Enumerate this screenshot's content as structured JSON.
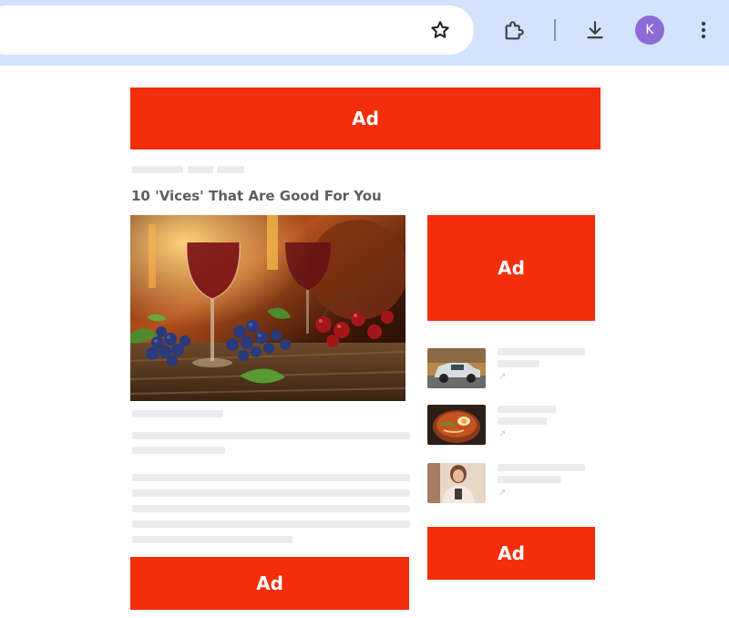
{
  "browser": {
    "profile_initial": "K",
    "icons": [
      "star-icon",
      "extensions-icon",
      "download-icon",
      "more-vert-icon"
    ]
  },
  "page": {
    "article_title": "10 'Vices' That Are Good For You",
    "ads": {
      "top": "Ad",
      "right": "Ad",
      "right_lower": "Ad",
      "bottom": "Ad"
    },
    "hero_image": "wine glasses, grapes and cherries on a rustic table",
    "related": [
      {
        "thumbnail": "silver SUV on a road",
        "icon": "arrow-up-right-icon"
      },
      {
        "thumbnail": "bowl of ramen with egg",
        "icon": "arrow-up-right-icon"
      },
      {
        "thumbnail": "woman holding a phone",
        "icon": "arrow-up-right-icon"
      }
    ]
  },
  "colors": {
    "ad_background": "#f42d0a",
    "chrome_toolbar": "#d3e3fd",
    "avatar": "#8e6cd8",
    "placeholder": "#ebebeb"
  }
}
